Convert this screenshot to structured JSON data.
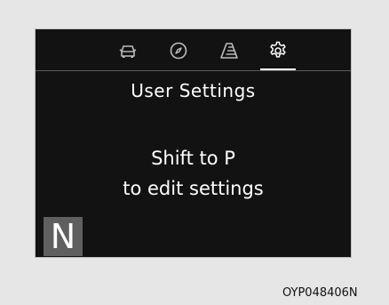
{
  "tabs": [
    {
      "icon": "car-icon",
      "label": "Vehicle"
    },
    {
      "icon": "compass-icon",
      "label": "Navigation"
    },
    {
      "icon": "road-icon",
      "label": "Driving Assist"
    },
    {
      "icon": "gear-icon",
      "label": "User Settings",
      "active": true
    }
  ],
  "screen": {
    "title": "User Settings",
    "message_line1": "Shift to P",
    "message_line2": "to edit settings"
  },
  "gear_position": "N",
  "caption": "OYP048406N",
  "colors": {
    "screen_bg": "#121212",
    "text": "#ffffff",
    "icon": "#bdbdbd",
    "gear_badge": "#5f5f5f",
    "page_bg": "#e6e6e6"
  }
}
